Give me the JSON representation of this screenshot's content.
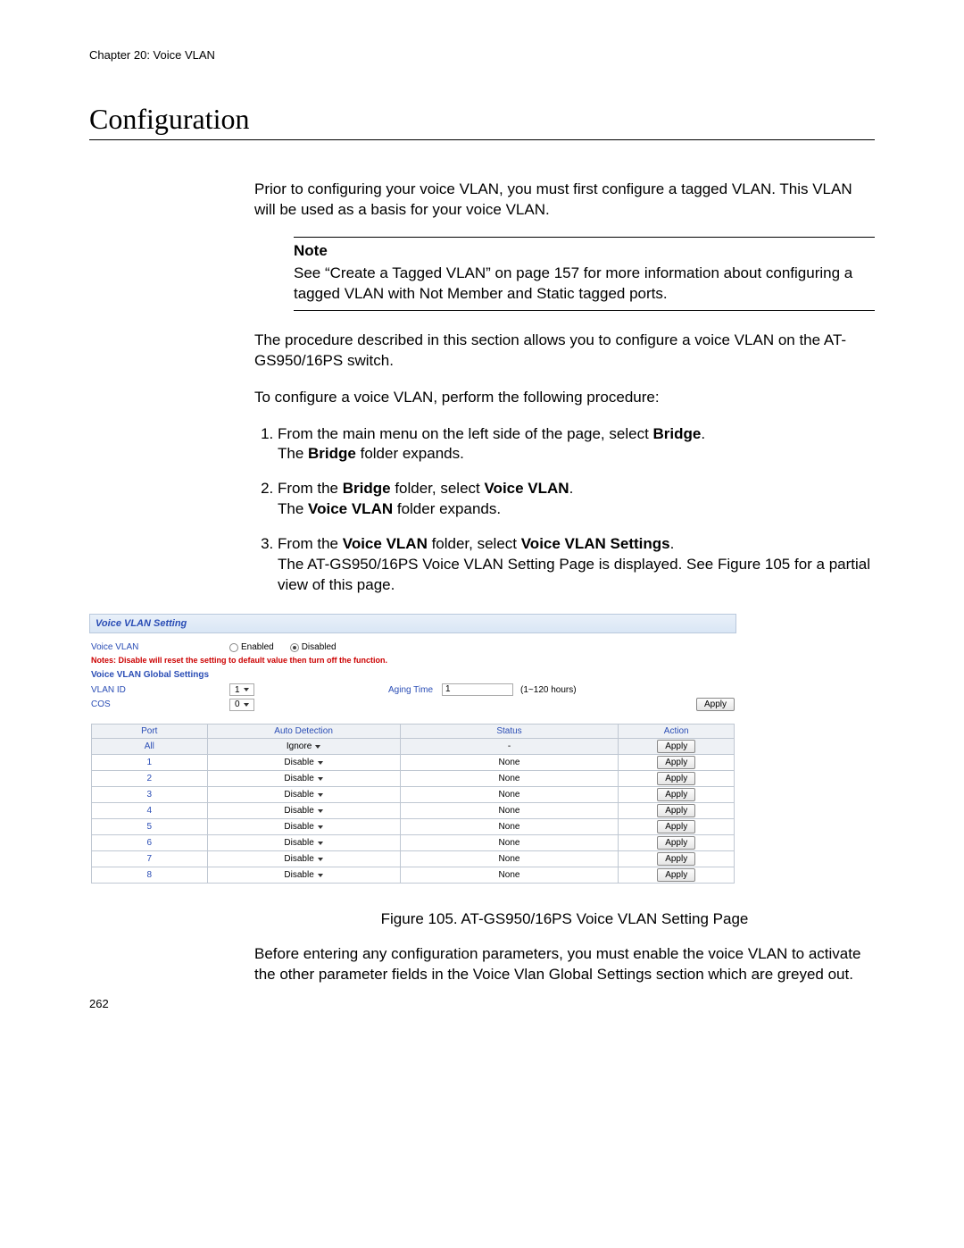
{
  "chapter_header": "Chapter 20: Voice VLAN",
  "section_title": "Configuration",
  "intro_paragraph": "Prior to configuring your voice VLAN, you must first configure a tagged VLAN. This VLAN will be used as a basis for your voice VLAN.",
  "note": {
    "head": "Note",
    "body": "See “Create a Tagged VLAN” on page 157 for more information about configuring a tagged VLAN with Not Member and Static tagged ports."
  },
  "para_after_note_1": "The procedure described in this section allows you to configure a voice VLAN on the AT-GS950/16PS switch.",
  "para_after_note_2": "To configure a voice VLAN, perform the following procedure:",
  "steps": [
    {
      "pre": "From the main menu on the left side of the page, select ",
      "b1": "Bridge",
      "mid": ".",
      "line2_pre": "The ",
      "line2_b": "Bridge",
      "line2_post": " folder expands."
    },
    {
      "pre": "From the ",
      "b1": "Bridge",
      "mid": " folder, select ",
      "b2": "Voice VLAN",
      "post": ".",
      "line2_pre": "The ",
      "line2_b": "Voice VLAN",
      "line2_post": " folder expands."
    },
    {
      "pre": "From the ",
      "b1": "Voice VLAN",
      "mid": " folder, select ",
      "b2": "Voice VLAN Settings",
      "post": ".",
      "line2": "The AT-GS950/16PS Voice VLAN Setting Page is displayed. See Figure 105 for a partial view of this page."
    }
  ],
  "figure": {
    "panel_title": "Voice VLAN Setting",
    "voice_vlan_label": "Voice VLAN",
    "enabled_label": "Enabled",
    "disabled_label": "Disabled",
    "warn_text": "Notes: Disable will reset the setting to default value then turn off the function.",
    "global_heading": "Voice VLAN Global Settings",
    "vlan_id_label": "VLAN ID",
    "vlan_id_value": "1",
    "aging_label": "Aging Time",
    "aging_value": "1",
    "aging_hint": "(1~120 hours)",
    "cos_label": "COS",
    "cos_value": "0",
    "apply_label": "Apply",
    "table": {
      "headers": {
        "port": "Port",
        "auto": "Auto Detection",
        "status": "Status",
        "action": "Action"
      },
      "all_row": {
        "port": "All",
        "auto": "Ignore",
        "status": "-"
      },
      "rows": [
        {
          "port": "1",
          "auto": "Disable",
          "status": "None"
        },
        {
          "port": "2",
          "auto": "Disable",
          "status": "None"
        },
        {
          "port": "3",
          "auto": "Disable",
          "status": "None"
        },
        {
          "port": "4",
          "auto": "Disable",
          "status": "None"
        },
        {
          "port": "5",
          "auto": "Disable",
          "status": "None"
        },
        {
          "port": "6",
          "auto": "Disable",
          "status": "None"
        },
        {
          "port": "7",
          "auto": "Disable",
          "status": "None"
        },
        {
          "port": "8",
          "auto": "Disable",
          "status": "None"
        }
      ]
    },
    "caption": "Figure 105. AT-GS950/16PS Voice VLAN Setting Page"
  },
  "closing_paragraph": "Before entering any configuration parameters, you must enable the voice VLAN to activate the other parameter fields in the Voice Vlan Global Settings section which are greyed out.",
  "page_number": "262"
}
